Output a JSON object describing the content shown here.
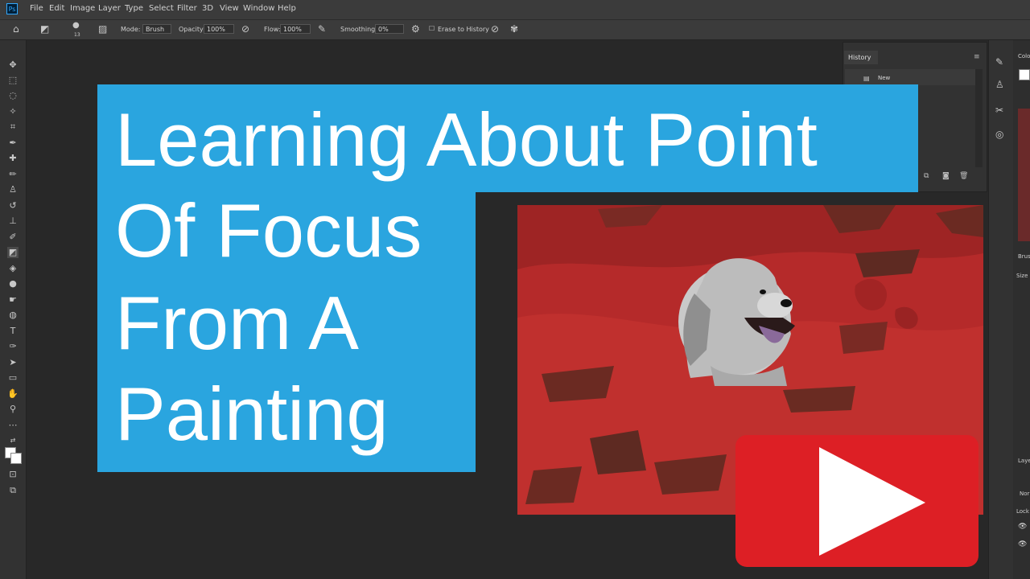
{
  "app": {
    "logo": "Ps"
  },
  "menu": [
    "File",
    "Edit",
    "Image",
    "Layer",
    "Type",
    "Select",
    "Filter",
    "3D",
    "View",
    "Window",
    "Help"
  ],
  "options": {
    "brush_size": "13",
    "mode_label": "Mode:",
    "mode_value": "Brush",
    "opacity_label": "Opacity:",
    "opacity_value": "100%",
    "flow_label": "Flow:",
    "flow_value": "100%",
    "smoothing_label": "Smoothing:",
    "smoothing_value": "0%",
    "erase_to_history": "Erase to History"
  },
  "history": {
    "title": "History",
    "item": "New"
  },
  "right_panel": {
    "color_tab": "Colo",
    "brush_label": "Brus",
    "size_label": "Size",
    "layers_label": "Laye",
    "normal_label": "Nor",
    "lock_label": "Lock"
  },
  "title_card": {
    "lines": [
      "Learning About Point",
      "Of Focus",
      "From A",
      "Painting"
    ]
  },
  "colors": {
    "accent_blue": "#2aa5df",
    "youtube_red": "#dd1f25",
    "painting_red": "#b52a2a"
  },
  "icons": {
    "play": "play-icon",
    "home": "home-icon",
    "eraser": "eraser-icon"
  }
}
